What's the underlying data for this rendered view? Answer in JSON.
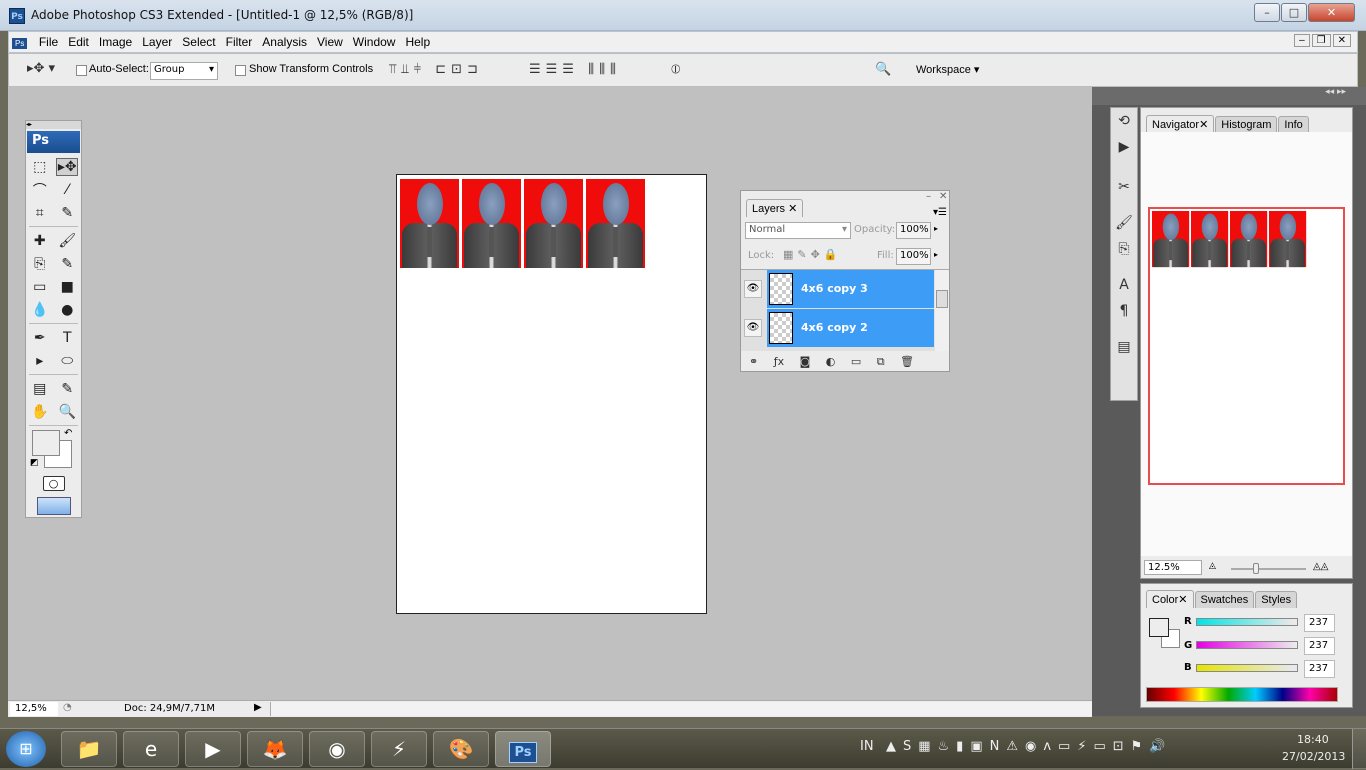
{
  "window": {
    "title": "Adobe Photoshop CS3 Extended - [Untitled-1 @ 12,5% (RGB/8)]",
    "app_icon": "Ps",
    "minimize": "–",
    "maximize": "□",
    "close": "✕"
  },
  "menu": [
    "File",
    "Edit",
    "Image",
    "Layer",
    "Select",
    "Filter",
    "Analysis",
    "View",
    "Window",
    "Help"
  ],
  "doc_window_buttons": [
    "–",
    "❐",
    "✕"
  ],
  "options": {
    "auto_select_label": "Auto-Select:",
    "auto_select_checked": false,
    "auto_select_value": "Group",
    "show_transform_label": "Show Transform Controls",
    "show_transform_checked": false,
    "workspace_label": "Workspace ▾"
  },
  "toolbox": {
    "header": "Ps",
    "tools": [
      [
        "⬚",
        "▸✥"
      ],
      [
        "⌒",
        "⁄"
      ],
      [
        "⌗",
        "✎"
      ],
      [
        "✚",
        "🖌"
      ],
      [
        "⎘",
        "✎"
      ],
      [
        "▭",
        "■"
      ],
      [
        "💧",
        "●"
      ],
      [
        "✒",
        "T"
      ],
      [
        "▸",
        "⬭"
      ],
      [
        "▤",
        "✎"
      ],
      [
        "✋",
        "🔍"
      ]
    ]
  },
  "layers": {
    "tab": "Layers",
    "blend_mode": "Normal",
    "opacity_label": "Opacity:",
    "opacity": "100%",
    "lock_label": "Lock:",
    "fill_label": "Fill:",
    "fill": "100%",
    "rows": [
      {
        "name": "4x6 copy 3",
        "visible": true,
        "selected": true
      },
      {
        "name": "4x6 copy 2",
        "visible": true,
        "selected": true
      }
    ],
    "footer_icons": [
      "link-icon",
      "fx-icon",
      "mask-icon",
      "adjustment-icon",
      "folder-icon",
      "new-layer-icon",
      "trash-icon"
    ]
  },
  "navigator": {
    "tabs": [
      "Navigator",
      "Histogram",
      "Info"
    ],
    "zoom": "12.5%",
    "view_box_color": "#e84c4c"
  },
  "color": {
    "tabs": [
      "Color",
      "Swatches",
      "Styles"
    ],
    "channels": [
      {
        "label": "R",
        "value": "237",
        "gradient": "#00e5e5"
      },
      {
        "label": "G",
        "value": "237",
        "gradient": "#e500e5"
      },
      {
        "label": "B",
        "value": "237",
        "gradient": "#e5e500"
      }
    ]
  },
  "status": {
    "zoom": "12,5%",
    "doc": "Doc: 24,9M/7,71M"
  },
  "taskbar": {
    "language": "IN",
    "time": "18:40",
    "date": "27/02/2013",
    "apps": [
      "explorer",
      "internet-explorer",
      "media-player",
      "firefox",
      "chrome",
      "winamp",
      "paint",
      "photoshop"
    ],
    "photoshop_label": "Ps"
  },
  "colors": {
    "accent": "#3d9cf5",
    "photo_bg": "#f10c0c",
    "workspace": "#c0c0c0"
  }
}
